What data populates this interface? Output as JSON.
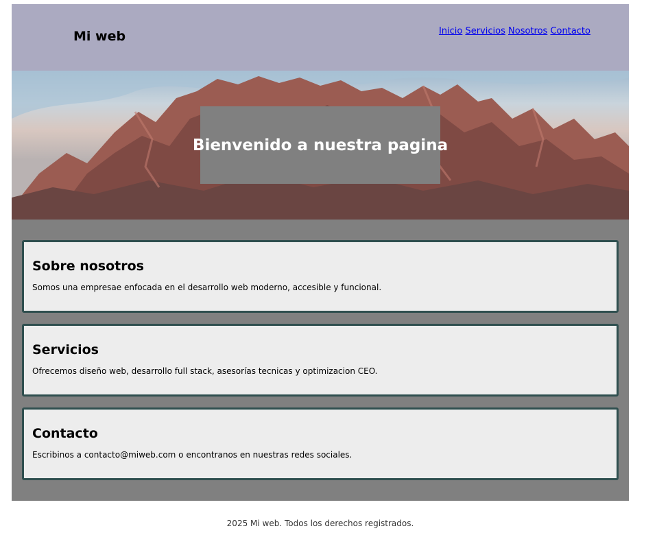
{
  "header": {
    "brand": "Mi web",
    "nav": [
      "Inicio",
      "Servicios",
      "Nosotros",
      "Contacto"
    ]
  },
  "hero": {
    "title": "Bienvenido a nuestra pagina"
  },
  "sections": [
    {
      "title": "Sobre nosotros",
      "text": "Somos una empresae enfocada en el desarrollo web moderno, accesible y funcional."
    },
    {
      "title": "Servicios",
      "text": "Ofrecemos diseño web, desarrollo full stack, asesorías tecnicas y optimizacion CEO."
    },
    {
      "title": "Contacto",
      "text": "Escribinos a contacto@miweb.com o encontranos en nuestras redes sociales."
    }
  ],
  "footer": {
    "text": "2025 Mi web. Todos los derechos registrados."
  },
  "colors": {
    "header_bg": "#abaac1",
    "main_bg": "#808080",
    "card_bg": "#ededed",
    "card_border": "#2f4f4f",
    "link": "#0000ee"
  }
}
